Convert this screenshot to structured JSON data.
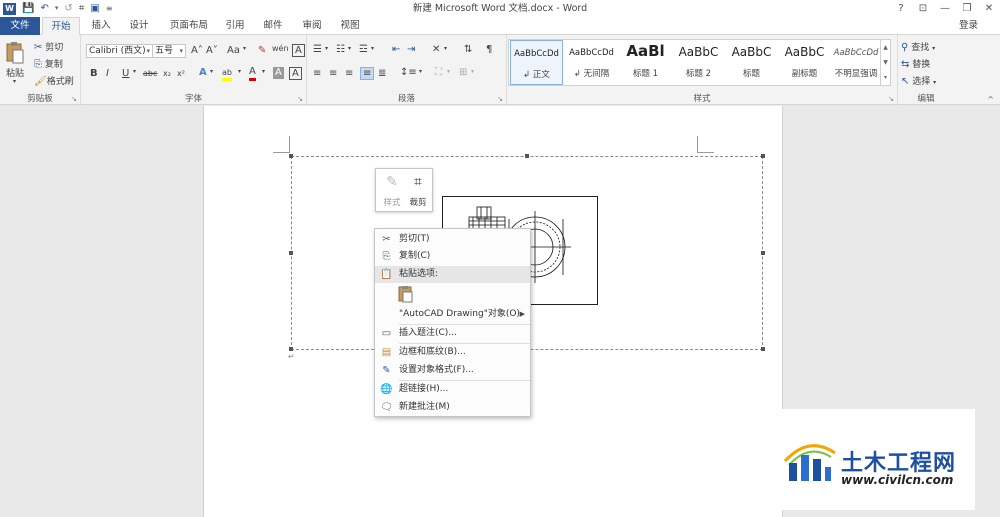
{
  "window": {
    "title": "新建 Microsoft Word 文档.docx - Word",
    "help": "?",
    "ribbon_display": "⊡",
    "minimize": "—",
    "restore": "❐",
    "close": "✕"
  },
  "qat": {
    "word_icon": "W",
    "save": "💾",
    "undo": "↶",
    "undo_drop": "▾",
    "redo": "↺",
    "crop": "⌗",
    "print": "▣",
    "customize": "≡"
  },
  "tabs": [
    {
      "label": "文件"
    },
    {
      "label": "开始"
    },
    {
      "label": "插入"
    },
    {
      "label": "设计"
    },
    {
      "label": "页面布局"
    },
    {
      "label": "引用"
    },
    {
      "label": "邮件"
    },
    {
      "label": "审阅"
    },
    {
      "label": "视图"
    }
  ],
  "login": "登录",
  "clipboard": {
    "paste": "粘贴",
    "cut": "剪切",
    "copy": "复制",
    "format_painter": "格式刷",
    "label": "剪贴板"
  },
  "font": {
    "name": "Calibri (西文)",
    "size": "五号",
    "label": "字体",
    "grow": "A˄",
    "shrink": "A˅",
    "case": "Aa",
    "clear": "✎",
    "wen": "wén",
    "a_box": "A",
    "bold": "B",
    "italic": "I",
    "underline": "U",
    "strike": "abc",
    "sub": "x₂",
    "sup": "x²",
    "effects": "A",
    "highlight": "ab",
    "color": "A",
    "shade": "A",
    "border": "A"
  },
  "paragraph": {
    "label": "段落"
  },
  "styles": {
    "label": "样式",
    "items": [
      {
        "sample": "AaBbCcDd",
        "name": "↲ 正文"
      },
      {
        "sample": "AaBbCcDd",
        "name": "↲ 无间隔"
      },
      {
        "sample": "AaBl",
        "name": "标题 1"
      },
      {
        "sample": "AaBbC",
        "name": "标题 2"
      },
      {
        "sample": "AaBbC",
        "name": "标题"
      },
      {
        "sample": "AaBbC",
        "name": "副标题"
      },
      {
        "sample": "AaBbCcDd",
        "name": "不明显强调"
      }
    ]
  },
  "editing": {
    "label": "编辑",
    "find": "查找",
    "replace": "替换",
    "select": "选择"
  },
  "minibar": {
    "style": "样式",
    "crop": "裁剪"
  },
  "context_menu": {
    "cut": "剪切(T)",
    "copy": "复制(C)",
    "paste_options": "粘贴选项:",
    "autocad": "\"AutoCAD Drawing\"对象(O)",
    "insert_caption": "插入题注(C)...",
    "borders": "边框和底纹(B)...",
    "format_object": "设置对象格式(F)...",
    "hyperlink": "超链接(H)...",
    "new_comment": "新建批注(M)"
  },
  "watermark": {
    "name": "土木工程网",
    "url": "www.civilcn.com"
  },
  "colors": {
    "accent": "#2b579a",
    "highlight": "#ffff00",
    "font_red": "#e00000"
  }
}
